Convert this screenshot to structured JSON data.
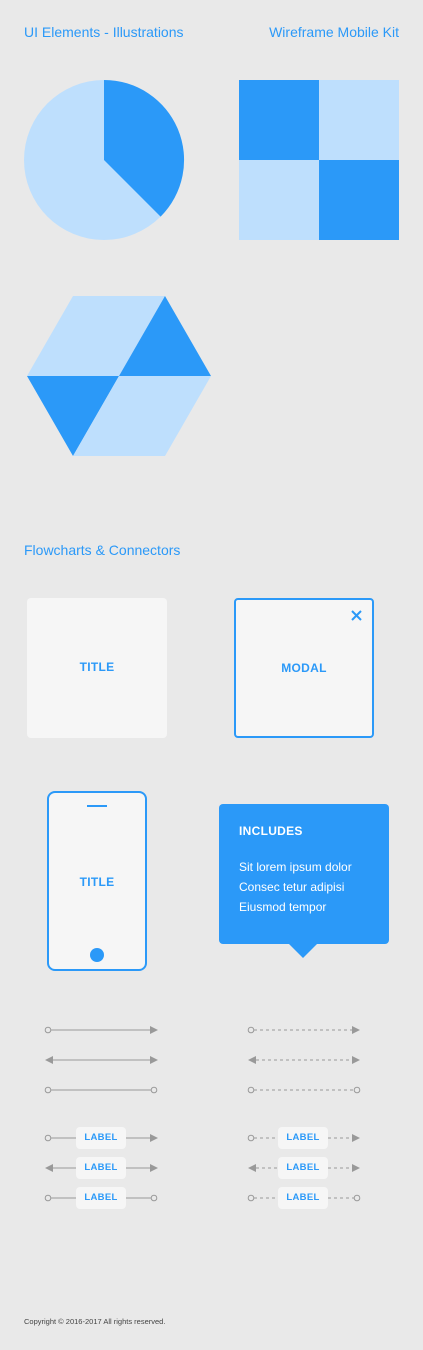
{
  "header": {
    "left_title": "UI Elements - Illustrations",
    "right_title": "Wireframe Mobile Kit"
  },
  "colors": {
    "accent": "#2b99f8",
    "light_accent": "#bedffd",
    "background": "#e9e9e9",
    "card": "#f6f6f6",
    "connector": "#999999"
  },
  "section_flowcharts": {
    "title": "Flowcharts & Connectors"
  },
  "cards": {
    "title_card": "TITLE",
    "modal_card": "MODAL",
    "modal_close_icon": "close-icon",
    "phone_title": "TITLE"
  },
  "tooltip": {
    "heading": "INCLUDES",
    "lines": [
      "Sit lorem ipsum dolor",
      "Consec tetur adipisi",
      "Eiusmod tempor"
    ]
  },
  "connectors": {
    "label": "LABEL",
    "styles": [
      "solid",
      "dashed"
    ],
    "endings": [
      "circle-to-arrow",
      "arrow-to-arrow",
      "circle-to-circle"
    ]
  },
  "footer": {
    "copyright": "Copyright © 2016-2017 All rights reserved."
  }
}
